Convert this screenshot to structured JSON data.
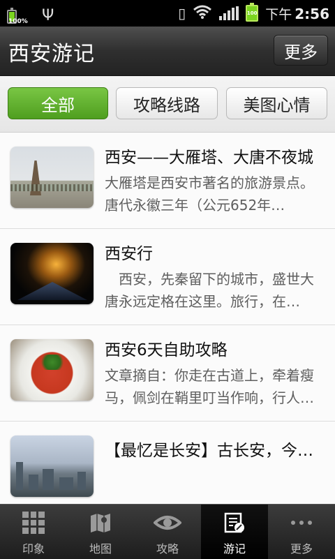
{
  "status_bar": {
    "battery_left_pct": "100%",
    "battery_right": "100",
    "time_prefix": "下午",
    "time": "2:56"
  },
  "header": {
    "title": "西安游记",
    "more_label": "更多"
  },
  "filters": [
    {
      "label": "全部",
      "active": true
    },
    {
      "label": "攻略线路",
      "active": false
    },
    {
      "label": "美图心情",
      "active": false
    }
  ],
  "items": [
    {
      "title": "西安——大雁塔、大唐不夜城",
      "desc": "大雁塔是西安市著名的旅游景点。唐代永徽三年（公元652年…",
      "thumb": "pagoda-square-photo"
    },
    {
      "title": "西安行",
      "desc": "　西安，先秦留下的城市，盛世大唐永远定格在这里。旅行，在…",
      "thumb": "night-palace-photo"
    },
    {
      "title": "西安6天自助攻略",
      "desc": "文章摘自：你走在古道上，牵着瘦马，佩剑在鞘里叮当作响，行人…",
      "thumb": "noodles-photo"
    },
    {
      "title": "【最忆是长安】古长安，今…",
      "desc": "",
      "thumb": "city-skyline-photo"
    }
  ],
  "nav": [
    {
      "label": "印象",
      "icon": "grid-icon",
      "active": false
    },
    {
      "label": "地图",
      "icon": "map-icon",
      "active": false
    },
    {
      "label": "攻略",
      "icon": "eye-icon",
      "active": false
    },
    {
      "label": "游记",
      "icon": "note-edit-icon",
      "active": true
    },
    {
      "label": "更多",
      "icon": "more-dots-icon",
      "active": false
    }
  ],
  "colors": {
    "accent_green": "#5aa82a",
    "titlebar": "#2f2f2f"
  }
}
